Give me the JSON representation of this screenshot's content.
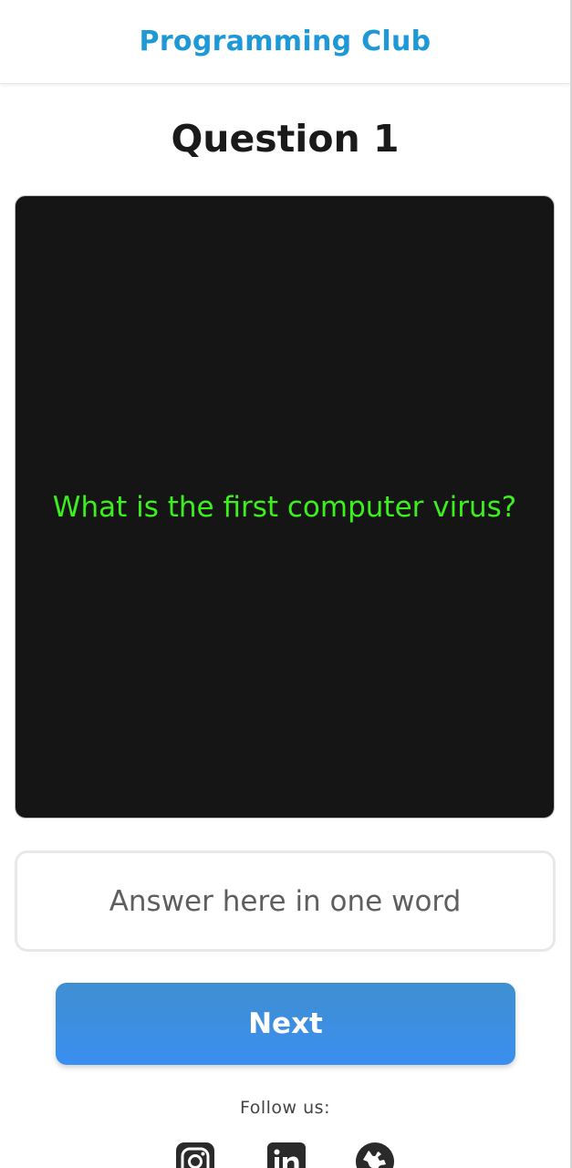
{
  "header": {
    "title": "Programming Club"
  },
  "quiz": {
    "question_heading": "Question 1",
    "question_text": "What is the first computer virus?",
    "answer_placeholder": "Answer here in one word",
    "next_label": "Next"
  },
  "footer": {
    "follow_label": "Follow us:",
    "social_icons": [
      "instagram-icon",
      "linkedin-icon",
      "globe-icon"
    ]
  },
  "colors": {
    "brand": "#1e98d6",
    "question_text": "#3cf01e",
    "card_background": "#151515",
    "button": "#3a8ff0"
  }
}
